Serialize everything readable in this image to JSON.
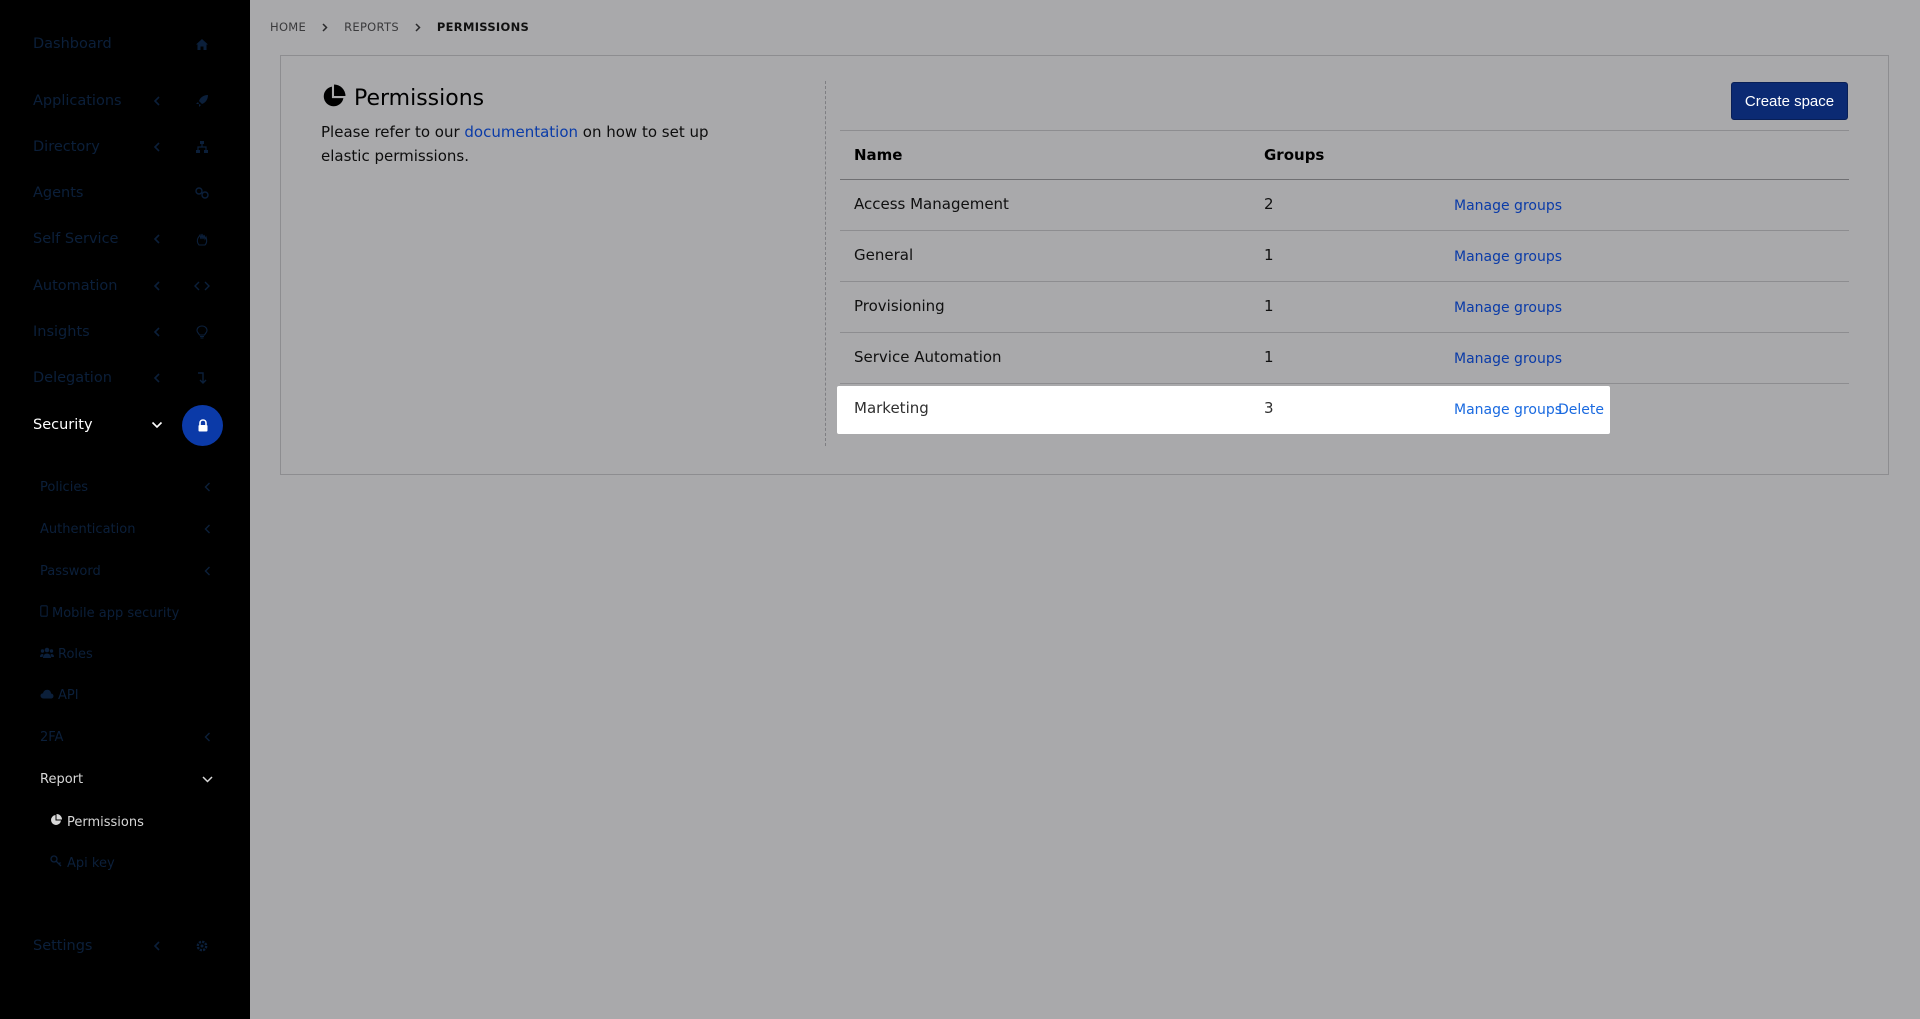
{
  "sidebar": {
    "items": [
      {
        "label": "Dashboard",
        "icon": "home-icon",
        "has_chevron": false
      },
      {
        "label": "Applications",
        "icon": "rocket-icon",
        "has_chevron": true
      },
      {
        "label": "Directory",
        "icon": "sitemap-icon",
        "has_chevron": true
      },
      {
        "label": "Agents",
        "icon": "agents-icon",
        "has_chevron": false
      },
      {
        "label": "Self Service",
        "icon": "hand-icon",
        "has_chevron": true
      },
      {
        "label": "Automation",
        "icon": "code-icon",
        "has_chevron": true
      },
      {
        "label": "Insights",
        "icon": "lightbulb-icon",
        "has_chevron": true
      },
      {
        "label": "Delegation",
        "icon": "level-down-icon",
        "has_chevron": true
      },
      {
        "label": "Security",
        "icon": "lock-icon",
        "has_chevron": true,
        "active": true
      }
    ],
    "security_sub": [
      {
        "label": "Policies",
        "has_chevron": true
      },
      {
        "label": "Authentication",
        "has_chevron": true
      },
      {
        "label": "Password",
        "has_chevron": true
      },
      {
        "label": "Mobile app security",
        "icon": "mobile-icon"
      },
      {
        "label": "Roles",
        "icon": "users-icon"
      },
      {
        "label": "API",
        "icon": "cloud-icon"
      },
      {
        "label": "2FA",
        "has_chevron": true
      },
      {
        "label": "Report",
        "has_chevron": true,
        "expanded": true
      }
    ],
    "report_sub": [
      {
        "label": "Permissions",
        "icon": "pie-chart-icon",
        "active": true
      },
      {
        "label": "Api key",
        "icon": "key-icon"
      }
    ],
    "settings": {
      "label": "Settings",
      "icon": "gear-icon"
    }
  },
  "breadcrumb": [
    "HOME",
    "REPORTS",
    "PERMISSIONS"
  ],
  "page": {
    "title": "Permissions",
    "desc_before": "Please refer to our ",
    "desc_link": "documentation",
    "desc_after": " on how to set up elastic permissions.",
    "create_button": "Create space"
  },
  "table": {
    "headers": {
      "name": "Name",
      "groups": "Groups"
    },
    "rows": [
      {
        "name": "Access Management",
        "groups": "2",
        "action": "Manage groups"
      },
      {
        "name": "General",
        "groups": "1",
        "action": "Manage groups"
      },
      {
        "name": "Provisioning",
        "groups": "1",
        "action": "Manage groups"
      },
      {
        "name": "Service Automation",
        "groups": "1",
        "action": "Manage groups"
      },
      {
        "name": "Marketing",
        "groups": "3",
        "action": "Manage groups",
        "delete": "Delete"
      }
    ]
  },
  "colors": {
    "accent": "#0b3aa8",
    "button": "#0b2a73",
    "sidebar": "#000000",
    "overlay": "#a9a9ab"
  }
}
